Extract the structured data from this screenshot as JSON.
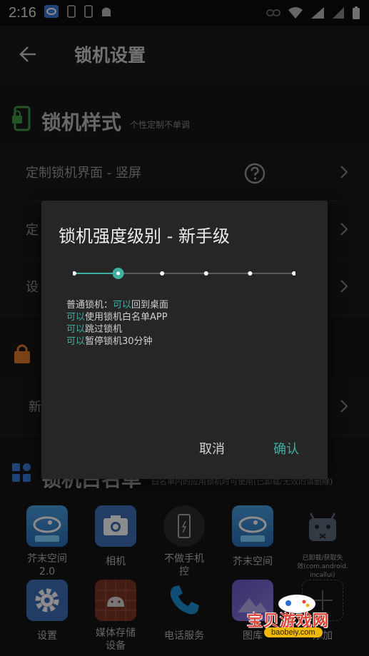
{
  "status_bar": {
    "time": "2:16"
  },
  "app_bar": {
    "title": "锁机设置"
  },
  "section_lock_style": {
    "title": "锁机样式",
    "subtitle": "个性定制不单调"
  },
  "rows": [
    {
      "label": "定制锁机界面 - 竖屏"
    },
    {
      "label": "定"
    },
    {
      "label": "设"
    },
    {
      "label": "新"
    }
  ],
  "section_whitelist": {
    "title": "锁机白名单",
    "subtitle": "白名单内的应用锁机时可使用(已卸载/无效的请删除)"
  },
  "apps": [
    {
      "label": "芥末空间\n2.0",
      "icon": "mustard-space-icon"
    },
    {
      "label": "相机",
      "icon": "camera-icon"
    },
    {
      "label": "不做手机\n控",
      "icon": "phone-detox-icon"
    },
    {
      "label": "芥末空间",
      "icon": "mustard-space-icon"
    },
    {
      "label": "已卸载/获取失\n效(com.android.\nincallui)",
      "icon": "android-broken-icon"
    },
    {
      "label": "设置",
      "icon": "settings-icon"
    },
    {
      "label": "媒体存储\n设备",
      "icon": "media-storage-icon"
    },
    {
      "label": "电话服务",
      "icon": "phone-icon"
    },
    {
      "label": "图库",
      "icon": "gallery-icon"
    },
    {
      "label": "添加",
      "icon": "add-icon"
    }
  ],
  "dialog": {
    "title": "锁机强度级别 - 新手级",
    "slider": {
      "steps": 6,
      "selected_index": 1
    },
    "lines": [
      {
        "prefix": "普通锁机：",
        "hl": "可以",
        "rest": "回到桌面"
      },
      {
        "prefix": "",
        "hl": "可以",
        "rest": "使用锁机白名单APP"
      },
      {
        "prefix": "",
        "hl": "可以",
        "rest": "跳过锁机"
      },
      {
        "prefix": "",
        "hl": "可以",
        "rest": "暂停锁机30分钟"
      }
    ],
    "cancel_label": "取消",
    "ok_label": "确认"
  },
  "watermark": {
    "text": "宝贝游戏网",
    "url": "baobeiy.com"
  },
  "colors": {
    "accent": "#3fb0a0",
    "background": "#121212",
    "dialog": "#262626",
    "lock_green": "#3c9a46",
    "lock_orange": "#e07a2a"
  }
}
